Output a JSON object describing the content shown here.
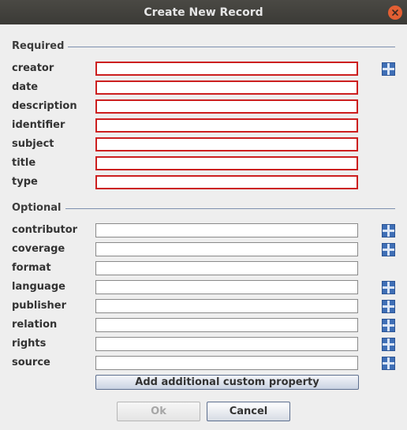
{
  "window": {
    "title": "Create New Record"
  },
  "sections": {
    "required": {
      "label": "Required"
    },
    "optional": {
      "label": "Optional"
    }
  },
  "required_fields": [
    {
      "label": "creator",
      "value": ""
    },
    {
      "label": "date",
      "value": ""
    },
    {
      "label": "description",
      "value": ""
    },
    {
      "label": "identifier",
      "value": ""
    },
    {
      "label": "subject",
      "value": ""
    },
    {
      "label": "title",
      "value": ""
    },
    {
      "label": "type",
      "value": ""
    }
  ],
  "optional_fields": [
    {
      "label": "contributor",
      "value": ""
    },
    {
      "label": "coverage",
      "value": ""
    },
    {
      "label": "format",
      "value": ""
    },
    {
      "label": "language",
      "value": ""
    },
    {
      "label": "publisher",
      "value": ""
    },
    {
      "label": "relation",
      "value": ""
    },
    {
      "label": "rights",
      "value": ""
    },
    {
      "label": "source",
      "value": ""
    }
  ],
  "buttons": {
    "add_custom": "Add additional custom property",
    "ok": "Ok",
    "cancel": "Cancel"
  },
  "colors": {
    "required_border": "#cc1f1f",
    "titlebar": "#3b3a36",
    "close_button": "#e35f33",
    "add_icon": "#3f6fb6"
  },
  "icons": {
    "close": "close-icon",
    "add": "plus-cross-icon"
  }
}
